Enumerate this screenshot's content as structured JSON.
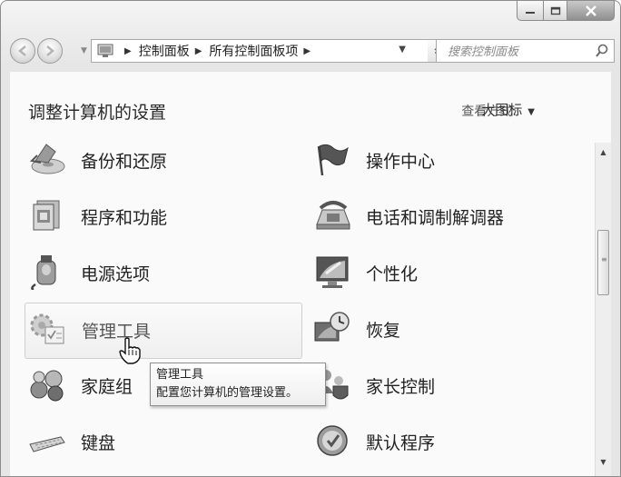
{
  "breadcrumb": {
    "items": [
      "控制面板",
      "所有控制面板项"
    ]
  },
  "search": {
    "placeholder": "搜索控制面板"
  },
  "header": {
    "title": "调整计算机的设置",
    "view_by_label": "查看方式:",
    "view_by_value": "大图标"
  },
  "items": {
    "backup": {
      "label": "备份和还原",
      "icon": "backup-restore-icon"
    },
    "action_center": {
      "label": "操作中心",
      "icon": "action-center-flag-icon"
    },
    "programs": {
      "label": "程序和功能",
      "icon": "programs-features-icon"
    },
    "phone_modem": {
      "label": "电话和调制解调器",
      "icon": "phone-modem-icon"
    },
    "power": {
      "label": "电源选项",
      "icon": "power-options-icon"
    },
    "personalization": {
      "label": "个性化",
      "icon": "personalization-icon"
    },
    "admin_tools": {
      "label": "管理工具",
      "icon": "administrative-tools-icon"
    },
    "recovery": {
      "label": "恢复",
      "icon": "recovery-icon"
    },
    "homegroup": {
      "label": "家庭组",
      "icon": "homegroup-icon"
    },
    "parental": {
      "label": "家长控制",
      "icon": "parental-controls-icon"
    },
    "keyboard": {
      "label": "键盘",
      "icon": "keyboard-icon"
    },
    "default_programs": {
      "label": "默认程序",
      "icon": "default-programs-icon"
    }
  },
  "tooltip": {
    "title": "管理工具",
    "description": "配置您计算机的管理设置。"
  }
}
